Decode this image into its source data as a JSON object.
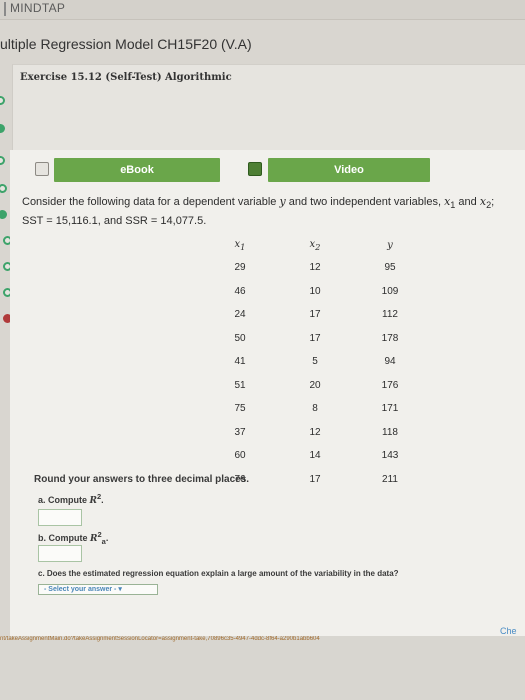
{
  "header": {
    "brand": "MINDTAP",
    "assignment_title": "ultiple Regression Model CH15F20 (V.A)"
  },
  "exercise": {
    "title": "Exercise 15.12 (Self-Test) Algorithmic"
  },
  "tabs": [
    {
      "label": "eBook",
      "icon": "book-icon"
    },
    {
      "label": "Video",
      "icon": "video-icon"
    }
  ],
  "question": {
    "line1_prefix": "Consider the following data for a dependent variable ",
    "var_y": "y",
    "line1_mid": " and two independent variables, ",
    "var_x1": "x",
    "sub1": "1",
    "and": " and ",
    "var_x2": "x",
    "sub2": "2",
    "line1_end": ";",
    "line2": "SST = 15,116.1, and SSR = 14,077.5."
  },
  "table": {
    "headers": {
      "x1": "x",
      "x1_sub": "1",
      "x2": "x",
      "x2_sub": "2",
      "y": "y"
    },
    "rows": [
      {
        "x1": "29",
        "x2": "12",
        "y": "95"
      },
      {
        "x1": "46",
        "x2": "10",
        "y": "109"
      },
      {
        "x1": "24",
        "x2": "17",
        "y": "112"
      },
      {
        "x1": "50",
        "x2": "17",
        "y": "178"
      },
      {
        "x1": "41",
        "x2": "5",
        "y": "94"
      },
      {
        "x1": "51",
        "x2": "20",
        "y": "176"
      },
      {
        "x1": "75",
        "x2": "8",
        "y": "171"
      },
      {
        "x1": "37",
        "x2": "12",
        "y": "118"
      },
      {
        "x1": "60",
        "x2": "14",
        "y": "143"
      },
      {
        "x1": "76",
        "x2": "17",
        "y": "211"
      }
    ]
  },
  "instructions": "Round your answers to three decimal places.",
  "part_a": {
    "label": "a. Compute ",
    "symbol": "R",
    "sup": "2",
    "end": "."
  },
  "part_b": {
    "label": "b. Compute ",
    "symbol": "R",
    "sub": "a",
    "sup": "2",
    "end": "."
  },
  "part_c": {
    "label": "c. Does the estimated regression equation explain a large amount of the variability in the data?",
    "select_value": "- Select your answer -"
  },
  "check_label": "Che",
  "status_url": "nt/takeAssignmentMain.do?takeAssignmentSessionLocator=assignment-take,70896c35-4947-4ddc-8f64-a290b1abb604"
}
